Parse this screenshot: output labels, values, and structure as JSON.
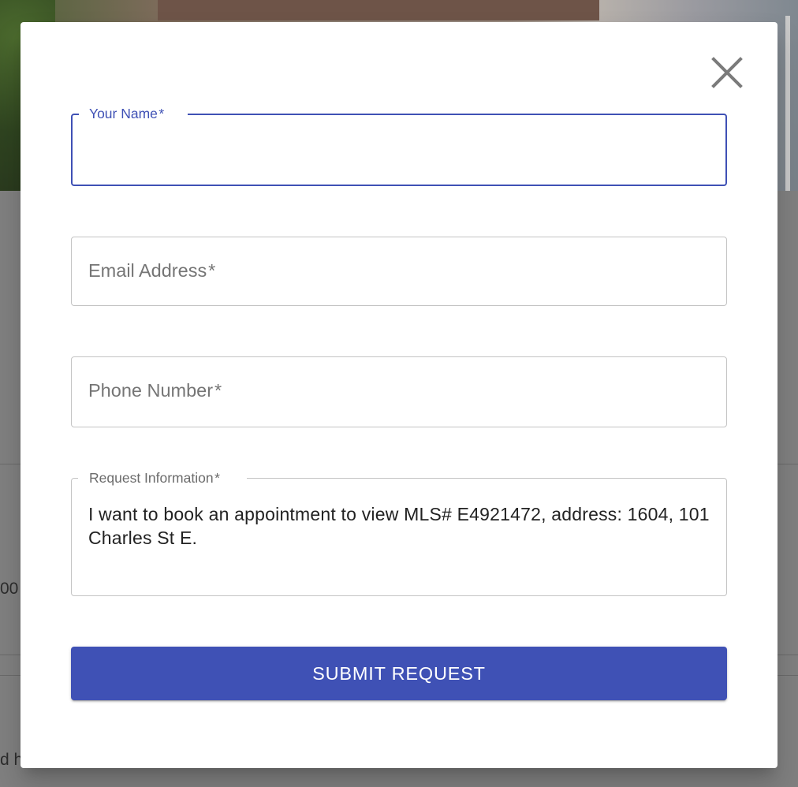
{
  "background": {
    "partial_text_left_1": "00",
    "partial_text_left_2": "d h"
  },
  "modal": {
    "close_icon": "close-icon",
    "fields": {
      "name": {
        "label": "Your Name",
        "required_mark": "*",
        "value": ""
      },
      "email": {
        "label": "Email Address",
        "required_mark": "*",
        "value": ""
      },
      "phone": {
        "label": "Phone Number",
        "required_mark": "*",
        "value": ""
      },
      "request": {
        "label": "Request Information",
        "required_mark": "*",
        "value": "I want to book an appointment to view MLS# E4921472, address: 1604, 101 Charles St E."
      }
    },
    "submit_label": "SUBMIT REQUEST"
  },
  "colors": {
    "primary": "#3f51b5",
    "border": "#c4c4c4",
    "label": "#757575",
    "overlay": "#808080"
  }
}
